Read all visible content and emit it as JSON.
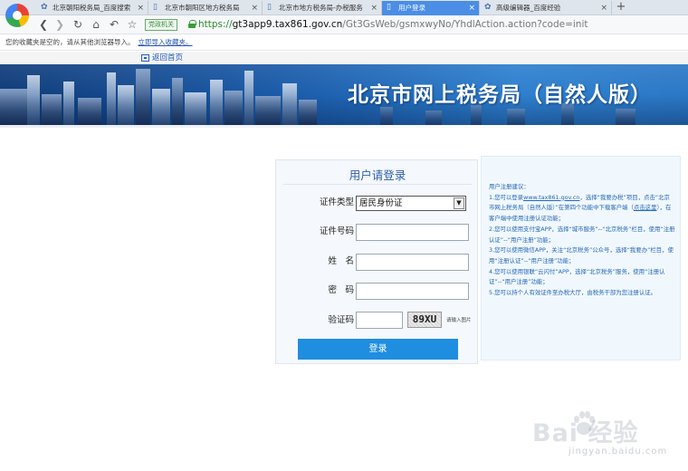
{
  "browser": {
    "tabs": [
      {
        "label": "北京朝阳税务局_百度搜索",
        "active": false
      },
      {
        "label": "北京市朝阳区地方税务局",
        "active": false
      },
      {
        "label": "北京市地方税务局-办税服务",
        "active": false
      },
      {
        "label": "用户登录",
        "active": true
      },
      {
        "label": "高级编辑器_百度经验",
        "active": false
      }
    ],
    "close_glyph": "×",
    "new_tab_glyph": "+",
    "gov_badge": "党政机关",
    "url": {
      "scheme": "https://",
      "host": "gt3app9.tax861.gov.cn",
      "path": "/Gt3GsWeb/gsmxwyNo/YhdlAction.action?code=init"
    },
    "fav_bar": {
      "text": "您的收藏夹是空的，请从其他浏览器导入。",
      "import_link": "立即导入收藏夹。"
    }
  },
  "page": {
    "back_link": "返回首页",
    "banner_title": "北京市网上税务局（自然人版）",
    "login": {
      "title": "用户请登录",
      "id_type_label": "证件类型",
      "id_type_value": "居民身份证",
      "id_number_label": "证件号码",
      "name_label": "姓　名",
      "password_label": "密　码",
      "captcha_label": "验证码",
      "captcha_code": "89XU",
      "refresh_hint": "请输入图片",
      "submit_label": "登录"
    },
    "help": {
      "heading": "用户注册建议：",
      "item1_a": "1.您可以登录",
      "item1_link": "www.tax861.gov.cn",
      "item1_b": "，选择“我要办税”项目，点击“北京市网上税务局（自然人版）”在第四个功能中下载客户端（",
      "item1_link2": "点击这里",
      "item1_c": "），在客户端中使用注册认证功能；",
      "item2": "2.您可以使用支付宝APP，选择“城市服务”--“北京税务”栏目，使用“注册认证”--“用户注册”功能；",
      "item3": "3.您可以使用微信APP，关注“北京税务”公众号，选择“我要办”栏目，使用“注册认证”--“用户注册”功能；",
      "item4": "4.您可以使用银联“云闪付”APP，选择“北京税务”服务，使用“注册认证”--“用户注册”功能；",
      "item5": "5.您可以持个人有效证件至办税大厅，由税务干部为您注册认证。"
    }
  },
  "watermark": {
    "text": "Bai  经验",
    "sub": "jingyan.baidu.com"
  },
  "colors": {
    "accent": "#1f8ee0",
    "active_tab": "#4a8ee6",
    "help_text": "#2568b8",
    "banner": "#1a5aa8"
  }
}
